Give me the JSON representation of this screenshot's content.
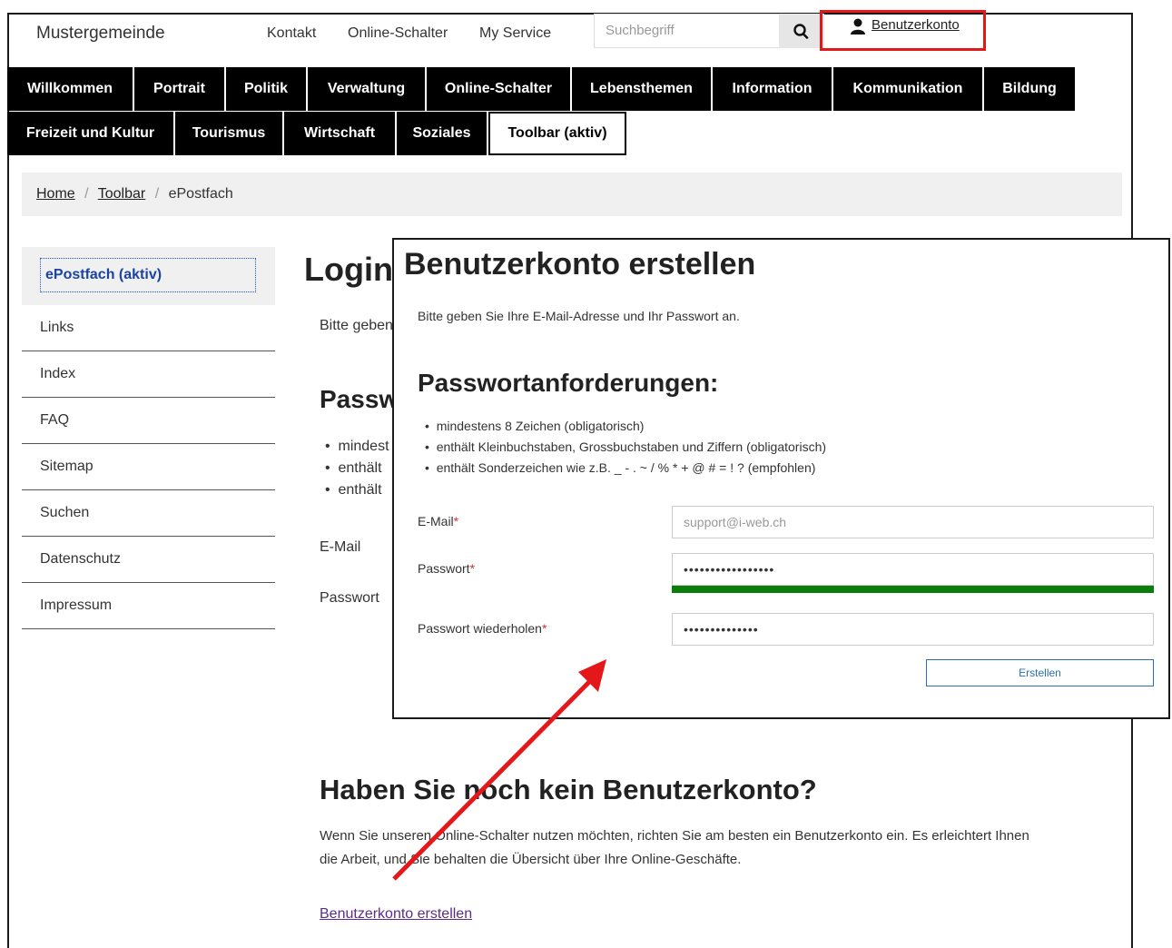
{
  "header": {
    "brand": "Mustergemeinde",
    "links": [
      "Kontakt",
      "Online-Schalter",
      "My Service"
    ],
    "search_placeholder": "Suchbegriff",
    "search_icon": "search-icon",
    "account_icon": "user-icon",
    "account_label": "Benutzerkonto",
    "highlight_color": "#e4181a"
  },
  "nav": {
    "row1": [
      "Willkommen",
      "Portrait",
      "Politik",
      "Verwaltung",
      "Online-Schalter",
      "Lebensthemen",
      "Information",
      "Kommunikation",
      "Bildung"
    ],
    "row2": [
      "Freizeit und Kultur",
      "Tourismus",
      "Wirtschaft",
      "Soziales",
      "Toolbar (aktiv)"
    ]
  },
  "breadcrumb": {
    "home": "Home",
    "sep": "/",
    "toolbar": "Toolbar",
    "current": "ePostfach"
  },
  "sidebar": {
    "active": "ePostfach (aktiv)",
    "items": [
      "Links",
      "Index",
      "FAQ",
      "Sitemap",
      "Suchen",
      "Datenschutz",
      "Impressum"
    ]
  },
  "main": {
    "title": "Login",
    "intro": "Bitte geben",
    "pw_heading": "Passw",
    "bullets": [
      "mindest",
      "enthält",
      "enthält"
    ],
    "email_label": "E-Mail",
    "password_label": "Passwort",
    "no_account_heading": "Haben Sie noch kein Benutzerkonto?",
    "no_account_text_1": "Wenn Sie unseren Online-Schalter nutzen möchten, richten Sie am besten ein Benutzerkonto ein. Es erleichtert Ihnen",
    "no_account_text_2": "die Arbeit, und Sie behalten die Übersicht über Ihre Online-Geschäfte.",
    "create_link": "Benutzerkonto erstellen"
  },
  "modal": {
    "title": "Benutzerkonto erstellen",
    "intro": "Bitte geben Sie Ihre E-Mail-Adresse und Ihr Passwort an.",
    "req_heading": "Passwortanforderungen:",
    "requirements": [
      "mindestens 8 Zeichen (obligatorisch)",
      "enthält Kleinbuchstaben, Grossbuchstaben und Ziffern (obligatorisch)",
      "enthält Sonderzeichen wie z.B. _ - . ~ / % * + @ # = ! ? (empfohlen)"
    ],
    "email_label": "E-Mail",
    "email_value": "support@i-web.ch",
    "password_label": "Passwort",
    "password_value": "•••••••••••••••••",
    "password_strength": 1.0,
    "strength_color": "#0a7d0a",
    "repeat_label": "Passwort wiederholen",
    "repeat_value": "••••••••••••••",
    "required_mark": "*",
    "submit_label": "Erstellen"
  },
  "annotation": {
    "arrow_color": "#e4181a"
  }
}
